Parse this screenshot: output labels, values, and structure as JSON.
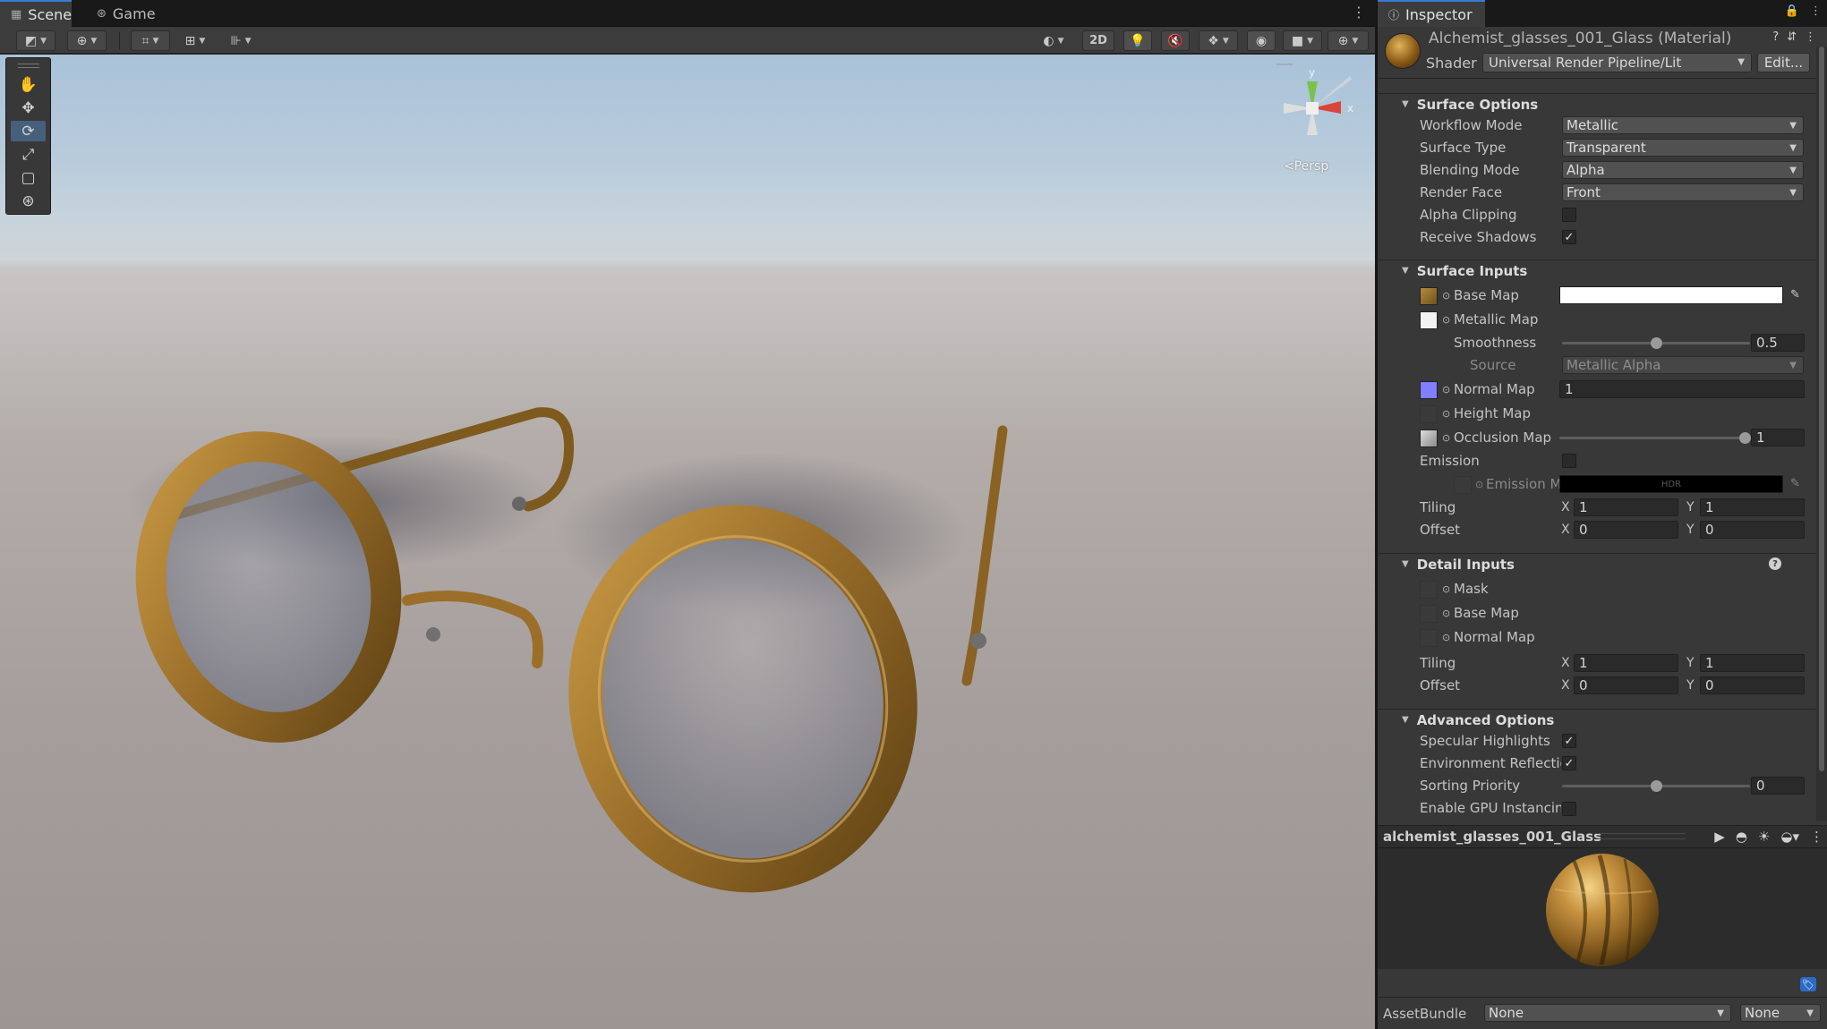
{
  "scene": {
    "tabs": [
      {
        "label": "Scene",
        "icon": "grid-icon",
        "active": true
      },
      {
        "label": "Game",
        "icon": "gamepad-icon",
        "active": false
      }
    ],
    "toolbar": {
      "mode_2d": "2D",
      "persp_label": "<Persp",
      "gizmo_axes": {
        "y": "y",
        "x": "x"
      }
    },
    "tools": [
      "hand-tool",
      "move-tool",
      "rotate-tool",
      "scale-tool",
      "rect-tool",
      "transform-tool"
    ],
    "active_tool": "rotate-tool"
  },
  "inspector": {
    "tab_label": "Inspector",
    "material_title": "Alchemist_glasses_001_Glass (Material)",
    "shader_label": "Shader",
    "shader_value": "Universal Render Pipeline/Lit",
    "edit_label": "Edit...",
    "surface_options": {
      "title": "Surface Options",
      "workflow_mode": {
        "label": "Workflow Mode",
        "value": "Metallic"
      },
      "surface_type": {
        "label": "Surface Type",
        "value": "Transparent"
      },
      "blending_mode": {
        "label": "Blending Mode",
        "value": "Alpha"
      },
      "render_face": {
        "label": "Render Face",
        "value": "Front"
      },
      "alpha_clipping": {
        "label": "Alpha Clipping",
        "checked": false
      },
      "receive_shadows": {
        "label": "Receive Shadows",
        "checked": true
      }
    },
    "surface_inputs": {
      "title": "Surface Inputs",
      "base_map": {
        "label": "Base Map",
        "color": "#ffffff"
      },
      "metallic_map": {
        "label": "Metallic Map"
      },
      "smoothness": {
        "label": "Smoothness",
        "value": "0.5",
        "fraction": 0.5
      },
      "source": {
        "label": "Source",
        "value": "Metallic Alpha"
      },
      "normal_map": {
        "label": "Normal Map",
        "value": "1"
      },
      "height_map": {
        "label": "Height Map"
      },
      "occlusion_map": {
        "label": "Occlusion Map",
        "value": "1",
        "fraction": 1.0
      },
      "emission": {
        "label": "Emission",
        "checked": false
      },
      "emission_map": {
        "label": "Emission M",
        "hdr": "HDR",
        "color": "#000000"
      },
      "tiling": {
        "label": "Tiling",
        "x": "1",
        "y": "1"
      },
      "offset": {
        "label": "Offset",
        "x": "0",
        "y": "0"
      }
    },
    "detail_inputs": {
      "title": "Detail Inputs",
      "mask": {
        "label": "Mask"
      },
      "base_map": {
        "label": "Base Map"
      },
      "normal_map": {
        "label": "Normal Map"
      },
      "tiling": {
        "label": "Tiling",
        "x": "1",
        "y": "1"
      },
      "offset": {
        "label": "Offset",
        "x": "0",
        "y": "0"
      }
    },
    "advanced_options": {
      "title": "Advanced Options",
      "specular_highlights": {
        "label": "Specular Highlights",
        "checked": true
      },
      "environment_reflections": {
        "label": "Environment Reflectio",
        "checked": true
      },
      "sorting_priority": {
        "label": "Sorting Priority",
        "value": "0",
        "fraction": 0.5
      },
      "gpu_instancing": {
        "label": "Enable GPU Instancin",
        "checked": false
      }
    },
    "axis_labels": {
      "x": "X",
      "y": "Y"
    },
    "preview": {
      "title": "alchemist_glasses_001_Glass"
    },
    "asset_bundle": {
      "label": "AssetBundle",
      "name": "None",
      "variant": "None"
    }
  },
  "colors": {
    "accent": "#3a7ad7",
    "glasses_frame": "#9b6f2a",
    "normal_map_swatch": "#7f7fff"
  }
}
